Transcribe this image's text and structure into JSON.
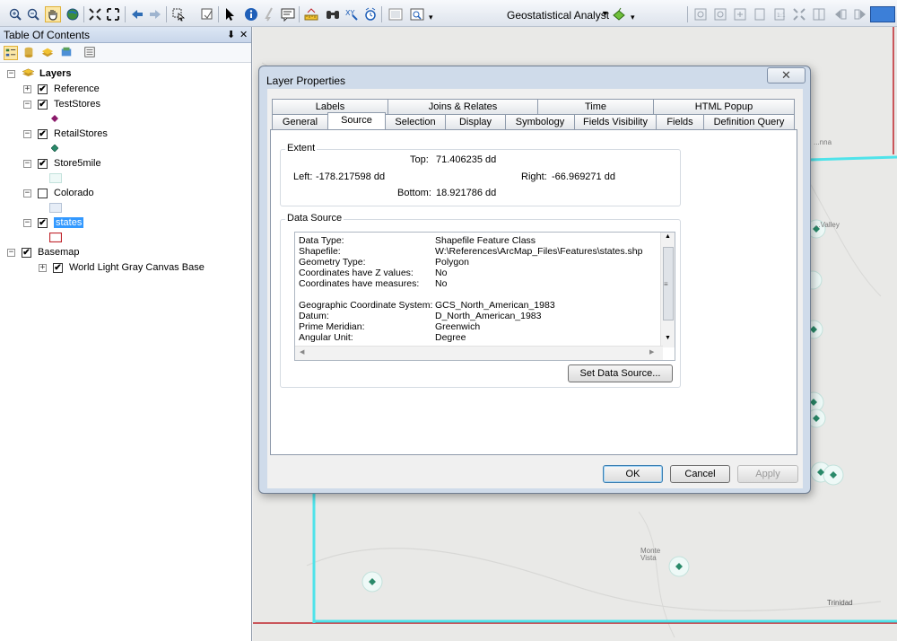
{
  "toolbar": {
    "geostatistical_label": "Geostatistical Analyst",
    "icons": [
      "zoom-in-icon",
      "zoom-out-icon",
      "pan-icon",
      "full-extent-icon",
      "fixed-zoom-in-icon",
      "fixed-zoom-out-icon",
      "back-icon",
      "forward-icon",
      "select-features-icon",
      "clear-selection-icon",
      "select-elements-icon",
      "identify-icon",
      "hyperlink-icon",
      "html-popup-icon",
      "measure-icon",
      "find-icon",
      "go-to-xy-icon",
      "time-slider-icon",
      "create-viewer-icon"
    ]
  },
  "toc": {
    "title": "Table Of Contents",
    "pin": "⬇",
    "close": "✕",
    "layers": [
      {
        "name": "Layers",
        "expander": "−"
      },
      {
        "name": "Reference",
        "expander": "+",
        "checked": "✔"
      },
      {
        "name": "TestStores",
        "expander": "−",
        "checked": "✔"
      },
      {
        "name": "RetailStores",
        "expander": "−",
        "checked": "✔"
      },
      {
        "name": "Store5mile",
        "expander": "−",
        "checked": "✔"
      },
      {
        "name": "Colorado",
        "expander": "−",
        "checked": ""
      },
      {
        "name": "states",
        "expander": "−",
        "checked": "✔"
      },
      {
        "name": "Basemap",
        "expander": "−",
        "checked": "✔"
      },
      {
        "name": "World Light Gray Canvas Base",
        "expander": "+",
        "checked": "✔"
      }
    ]
  },
  "map": {
    "labels": {
      "town1": "...nna",
      "town2": "...Valley",
      "town3": "Monte Vista",
      "town4": "Trinidad"
    },
    "state_border_color": "#4fe3ea",
    "selection_color": "#c0262d"
  },
  "dialog": {
    "title": "Layer Properties",
    "close": "✕",
    "tabs_row1": [
      "Labels",
      "Joins & Relates",
      "Time",
      "HTML Popup"
    ],
    "tabs_row2": [
      "General",
      "Source",
      "Selection",
      "Display",
      "Symbology",
      "Fields Visibility",
      "Fields",
      "Definition Query"
    ],
    "active_tab": "Source",
    "extent": {
      "title": "Extent",
      "top_label": "Top:",
      "top_value": "71.406235 dd",
      "left_label": "Left:",
      "left_value": "-178.217598 dd",
      "right_label": "Right:",
      "right_value": "-66.969271 dd",
      "bottom_label": "Bottom:",
      "bottom_value": "18.921786 dd"
    },
    "data_source": {
      "title": "Data Source",
      "rows": [
        {
          "k": "Data Type:",
          "v": "Shapefile Feature Class"
        },
        {
          "k": "Shapefile:",
          "v": "W:\\References\\ArcMap_Files\\Features\\states.shp"
        },
        {
          "k": "Geometry Type:",
          "v": "Polygon"
        },
        {
          "k": "Coordinates have Z values:",
          "v": "No"
        },
        {
          "k": "Coordinates have measures:",
          "v": "No"
        },
        {
          "k": "",
          "v": ""
        },
        {
          "k": "Geographic Coordinate System:",
          "v": "GCS_North_American_1983"
        },
        {
          "k": "Datum:",
          "v": "D_North_American_1983"
        },
        {
          "k": "Prime Meridian:",
          "v": "Greenwich"
        },
        {
          "k": "Angular Unit:",
          "v": "Degree"
        }
      ],
      "set_button": "Set Data Source..."
    },
    "buttons": {
      "ok": "OK",
      "cancel": "Cancel",
      "apply": "Apply"
    }
  }
}
